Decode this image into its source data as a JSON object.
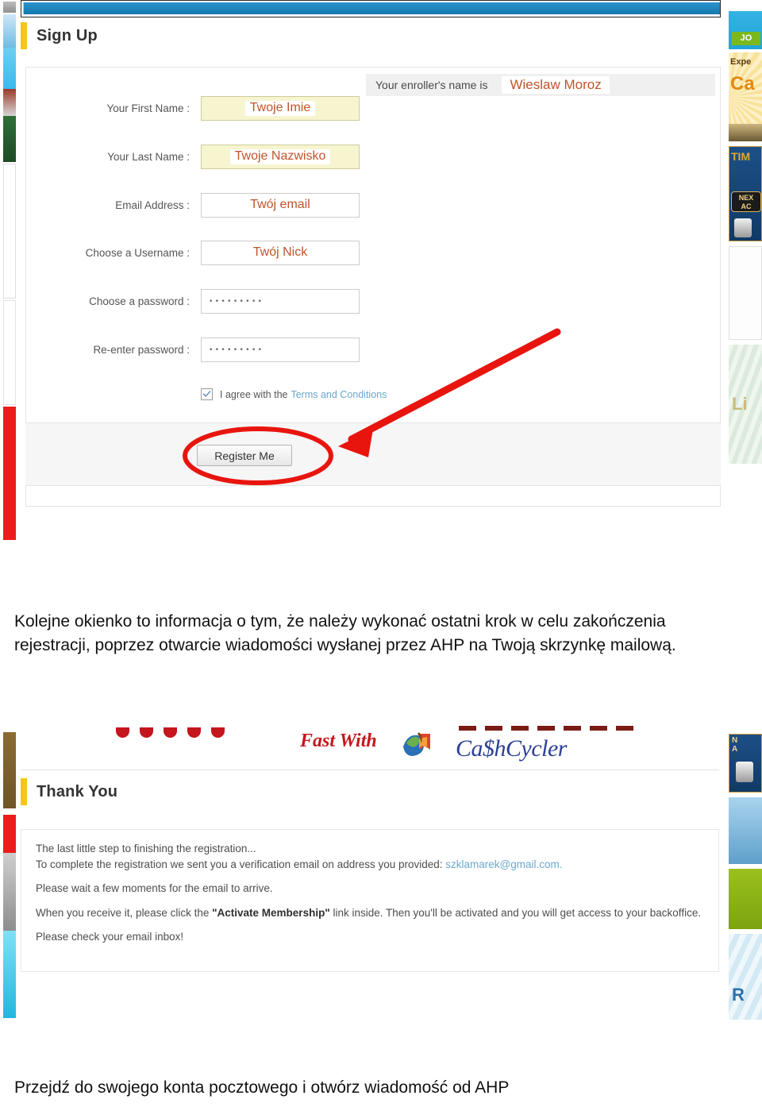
{
  "signup_screenshot": {
    "section_title": "Sign Up",
    "enroller": {
      "label": "Your enroller's name is",
      "name": "Wieslaw Moroz"
    },
    "fields": [
      {
        "label": "Your First Name :",
        "overlay": "Twoje Imie",
        "highlighted": true,
        "type": "text"
      },
      {
        "label": "Your Last Name :",
        "overlay": "Twoje Nazwisko",
        "highlighted": true,
        "type": "text"
      },
      {
        "label": "Email Address :",
        "overlay": "Twój email",
        "highlighted": false,
        "type": "text"
      },
      {
        "label": "Choose a Username :",
        "overlay": "Twój Nick",
        "highlighted": false,
        "type": "text"
      },
      {
        "label": "Choose a password :",
        "overlay": "",
        "highlighted": false,
        "type": "password",
        "masked": "•••••••••"
      },
      {
        "label": "Re-enter password :",
        "overlay": "",
        "highlighted": false,
        "type": "password",
        "masked": "•••••••••"
      }
    ],
    "terms": {
      "prefix": "I agree with the",
      "link": "Terms and Conditions",
      "checked": true
    },
    "submit_label": "Register Me"
  },
  "caption": {
    "middle": "Kolejne okienko to informacja o tym, że należy wykonać ostatni krok w celu zakończenia rejestracji, poprzez otwarcie wiadomości wysłanej przez AHP na Twoją skrzynkę mailową.",
    "bottom": "Przejdź do swojego konta pocztowego i otwórz wiadomość od AHP"
  },
  "thankyou_screenshot": {
    "banner": {
      "tagline": "Fast With",
      "brand": "Ca$hCycler"
    },
    "section_title": "Thank You",
    "lines": [
      "The last little step to finishing the registration...",
      "To complete the registration we sent you a verification email on address you provided:",
      "Please wait a few moments for the email to arrive.",
      "When you receive it, please click the",
      "link inside. Then you'll be activated and you will get access to your backoffice.",
      "Please check your email inbox!"
    ],
    "email": "szklamarek@gmail.com.",
    "activate_quoted": "\"Activate Membership\""
  },
  "colors": {
    "accent_yellow": "#f5c518",
    "topbar_blue": "#1e86c0",
    "overlay_orange": "#c0532b",
    "annotation_red": "#e8150f",
    "link_blue": "#69a8cf",
    "brand_blue": "#2b3f96",
    "brand_red": "#c4161c"
  }
}
